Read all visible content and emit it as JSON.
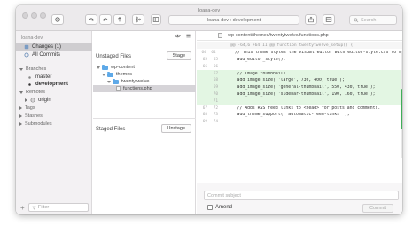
{
  "window": {
    "title": "loana-dev"
  },
  "toolbar": {
    "branch_display": "loana-dev : development",
    "search_placeholder": "Search"
  },
  "sidebar": {
    "repo": "loana-dev",
    "items": [
      {
        "label": "Changes (1)"
      },
      {
        "label": "All Commits"
      }
    ],
    "branches_header": "Branches",
    "branches": [
      {
        "label": "master"
      },
      {
        "label": "development"
      }
    ],
    "remotes_header": "Remotes",
    "remotes": [
      {
        "label": "origin"
      }
    ],
    "tags_header": "Tags",
    "stashes_header": "Stashes",
    "submodules_header": "Submodules",
    "filter_placeholder": "Filter"
  },
  "middle": {
    "unstaged_title": "Unstaged Files",
    "stage_label": "Stage",
    "tree": [
      {
        "label": "wp-content"
      },
      {
        "label": "themes"
      },
      {
        "label": "twentytwelve"
      },
      {
        "label": "functions.php"
      }
    ],
    "staged_title": "Staged Files",
    "unstage_label": "Unstage"
  },
  "diff": {
    "path": "wp-content/themes/twentytwelve/functions.php",
    "hunk": "@@ -64,6 +64,11 @@ function twentytwelve_setup() {",
    "lines": [
      {
        "old": "64",
        "new": "64",
        "text": "    // This theme styles the visual editor with editor-style.css to match the",
        "added": false
      },
      {
        "old": "65",
        "new": "65",
        "text": "    add_editor_style();",
        "added": false
      },
      {
        "old": "66",
        "new": "66",
        "text": "",
        "added": false
      },
      {
        "old": "",
        "new": "67",
        "text": "    // Image thumbnails",
        "added": true
      },
      {
        "old": "",
        "new": "68",
        "text": "    add_image_size( 'large', 730, 400, true );",
        "added": true
      },
      {
        "old": "",
        "new": "69",
        "text": "    add_image_size( 'general-thumbnail', 550, 430, true );",
        "added": true
      },
      {
        "old": "",
        "new": "70",
        "text": "    add_image_size( 'sidebar-thumbnail', 190, 160, true );",
        "added": true
      },
      {
        "old": "",
        "new": "71",
        "text": "",
        "added": true
      },
      {
        "old": "67",
        "new": "72",
        "text": "    // Adds RSS feed links to <head> for posts and comments.",
        "added": false
      },
      {
        "old": "68",
        "new": "73",
        "text": "    add_theme_support( 'automatic-feed-links' );",
        "added": false
      },
      {
        "old": "69",
        "new": "74",
        "text": "",
        "added": false
      }
    ]
  },
  "commit": {
    "subject_placeholder": "Commit subject",
    "amend_label": "Amend",
    "commit_label": "Commit"
  }
}
